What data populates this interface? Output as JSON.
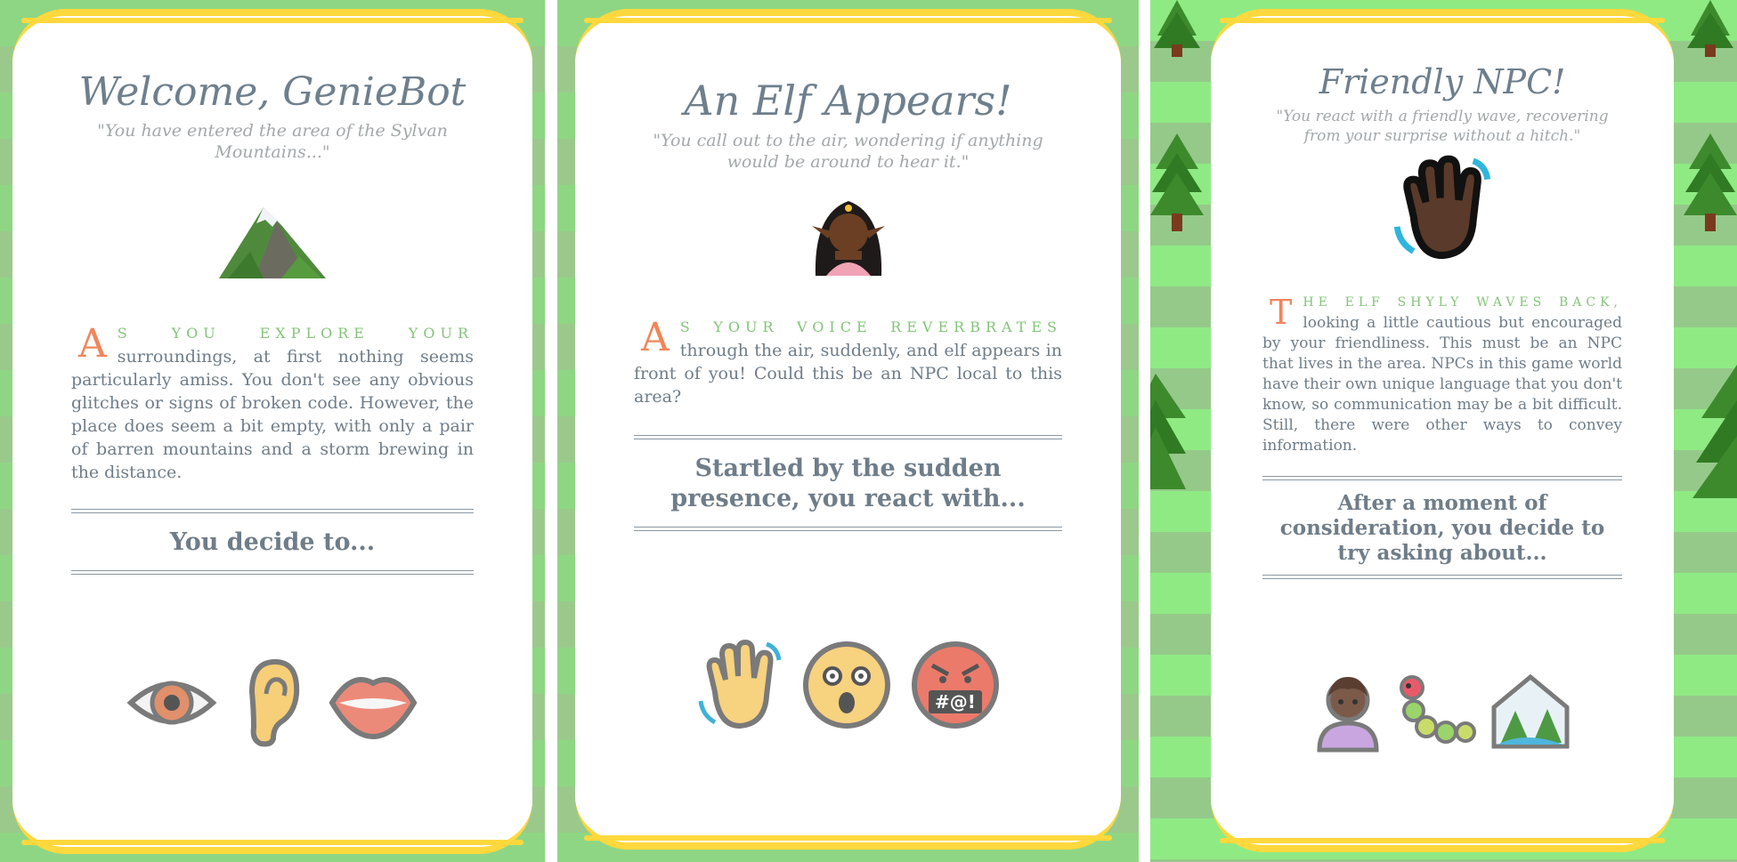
{
  "cards": [
    {
      "title": "Welcome, GenieBot",
      "quote": "\"You have entered the area of the Sylvan Mountains...\"",
      "hero_icon": "snow-capped-mountain-icon",
      "drop_cap": "A",
      "lead_words": "s you explore your",
      "body": "surroundings, at first nothing seems particularly amiss. You don't see any obvious glitches or signs of broken code. However, the place does seem a bit empty, with only a pair of barren mountains and a storm brewing in the distance.",
      "prompt": "You decide to...",
      "choices": [
        "eye-icon",
        "ear-icon",
        "mouth-icon"
      ]
    },
    {
      "title": "An Elf Appears!",
      "quote": "\"You call out to the air, wondering if anything would be around to hear it.\"",
      "hero_icon": "elf-icon",
      "drop_cap": "A",
      "lead_words": "s your voice reverbrates",
      "body": "through the air, suddenly, and elf appears in front of you! Could this be an NPC local to this area?",
      "prompt": "Startled by the sudden presence, you react with...",
      "choices": [
        "waving-hand-icon",
        "shocked-face-icon",
        "angry-face-icon"
      ],
      "angry_symbols": "#@!"
    },
    {
      "title": "Friendly NPC!",
      "quote": "\"You react with a friendly wave, recovering from your surprise without a hitch.\"",
      "hero_icon": "waving-hand-icon",
      "drop_cap": "T",
      "lead_words": "he elf shyly waves back,",
      "body": "looking a little cautious but encouraged by your friendliness. This must be an NPC that lives in the area. NPCs in this game world have their own unique language that you don't know, so communication may be a bit difficult. Still, there were other ways to convey information.",
      "prompt": "After a moment of consideration, you decide to try asking about...",
      "choices": [
        "person-icon",
        "caterpillar-icon",
        "landscape-icon"
      ]
    }
  ],
  "colors": {
    "border": "#ffd83d",
    "title": "#6e7f8d",
    "drop_cap": "#f0855a",
    "lead": "#83c479",
    "grass_light": "#8fd684",
    "grass_dark": "#9bc98c"
  }
}
